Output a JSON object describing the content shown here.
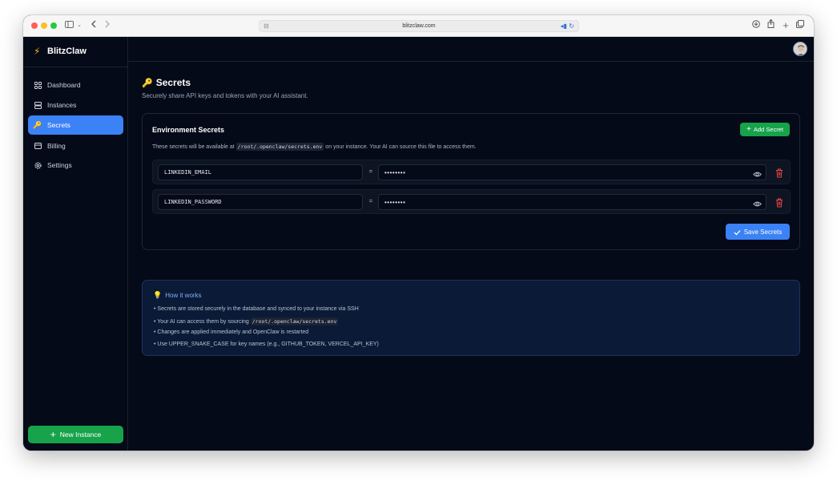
{
  "browser": {
    "url": "blitzclaw.com"
  },
  "sidebar": {
    "brand": "BlitzClaw",
    "items": [
      {
        "label": "Dashboard",
        "icon": "grid-icon"
      },
      {
        "label": "Instances",
        "icon": "server-icon"
      },
      {
        "label": "Secrets",
        "icon": "key-icon",
        "active": true
      },
      {
        "label": "Billing",
        "icon": "credit-card-icon"
      },
      {
        "label": "Settings",
        "icon": "gear-icon"
      }
    ],
    "new_instance_label": "New Instance"
  },
  "page": {
    "title": "Secrets",
    "subtitle": "Securely share API keys and tokens with your AI assistant."
  },
  "env_card": {
    "title": "Environment Secrets",
    "add_label": "Add Secret",
    "desc_before": "These secrets will be available at",
    "desc_path": "/root/.openclaw/secrets.env",
    "desc_after": "on your instance. Your AI can source this file to access them.",
    "rows": [
      {
        "key": "LINKEDIN_EMAIL",
        "value": "••••••••"
      },
      {
        "key": "LINKEDIN_PASSWORD",
        "value": "••••••••"
      }
    ],
    "equals": "=",
    "save_label": "Save Secrets"
  },
  "info": {
    "title": "How it works",
    "item1": "• Secrets are stored securely in the database and synced to your instance via SSH",
    "item2_before": "• Your AI can access them by sourcing",
    "item2_code": "/root/.openclaw/secrets.env",
    "item3": "• Changes are applied immediately and OpenClaw is restarted",
    "item4": "• Use UPPER_SNAKE_CASE for key names (e.g., GITHUB_TOKEN, VERCEL_API_KEY)"
  },
  "colors": {
    "accent": "#3b82f6",
    "success": "#16a34a",
    "danger": "#ef4444",
    "background": "#050a18"
  }
}
